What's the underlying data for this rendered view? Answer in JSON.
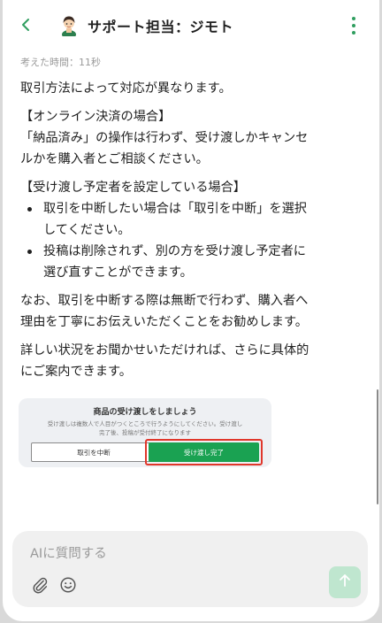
{
  "header": {
    "title": "サポート担当：ジモト"
  },
  "message": {
    "thinking_time": "考えた時間：11秒",
    "intro": "取引方法によって対応が異なります。",
    "online": {
      "heading": "【オンライン決済の場合】",
      "lines": [
        "「納品済み」の操作は行わず、受け渡しかキャンセ",
        "ルかを購入者とご相談ください。"
      ]
    },
    "scheduled": {
      "heading": "【受け渡し予定者を設定している場合】",
      "bullets": [
        {
          "lines": [
            "取引を中断したい場合は「取引を中断」を選択",
            "してください。"
          ]
        },
        {
          "lines": [
            "投稿は削除されず、別の方を受け渡し予定者に",
            "選び直すことができます。"
          ]
        }
      ]
    },
    "note_lines": [
      "なお、取引を中断する際は無断で行わず、購入者へ",
      "理由を丁寧にお伝えいただくことをお勧めします。"
    ],
    "closing_lines": [
      "詳しい状況をお聞かせいただければ、さらに具体的",
      "にご案内できます。"
    ]
  },
  "preview": {
    "title": "商品の受け渡しをしましょう",
    "desc_lines": [
      "受け渡しは複数人で人目がつくところで行うようにしてください。受け渡し",
      "完了後、投稿が受付終了になります"
    ],
    "cancel_label": "取引を中断",
    "done_label": "受け渡し完了"
  },
  "composer": {
    "placeholder": "AIに質問する"
  },
  "colors": {
    "accent": "#2f9e5f",
    "done_button": "#1aa252",
    "highlight": "#e0372b",
    "send_button": "#bfe6cf"
  },
  "icons": [
    "back-chevron-icon",
    "avatar-icon",
    "more-vertical-icon",
    "paperclip-icon",
    "smiley-icon",
    "arrow-up-icon"
  ]
}
